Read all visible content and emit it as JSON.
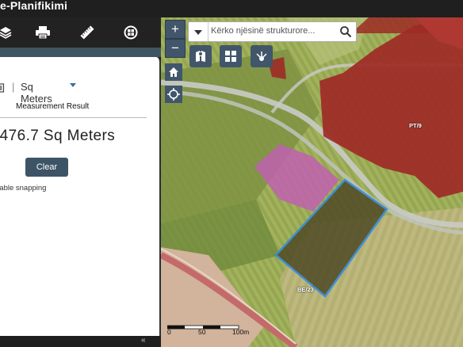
{
  "app": {
    "title": "e-Planifikimi"
  },
  "toolbar": {
    "icons": [
      "layers-icon",
      "print-icon",
      "measure-ruler-icon",
      "basemap-gallery-icon"
    ]
  },
  "measurement": {
    "unit_separator": "|",
    "unit": "Sq Meters",
    "result_label": "Measurement Result",
    "result_value": ",476.7 Sq Meters",
    "clear_label": "Clear",
    "snapping_text": "nable snapping"
  },
  "bottombar": {
    "collapse_glyph": "«"
  },
  "map": {
    "zoom_in": "+",
    "zoom_out": "−",
    "search": {
      "placeholder": "Kërko njësinë strukturore..."
    },
    "parcel_labels": {
      "pt9": "PT/9",
      "be23": "BE/23"
    },
    "scale": {
      "labels": [
        "0",
        "50",
        "100m"
      ]
    },
    "colors": {
      "residential_red": "#9e2a26",
      "pink_zone": "#c060b0",
      "selected_outline": "#2e8ae6",
      "control_bg": "#41566a"
    }
  }
}
